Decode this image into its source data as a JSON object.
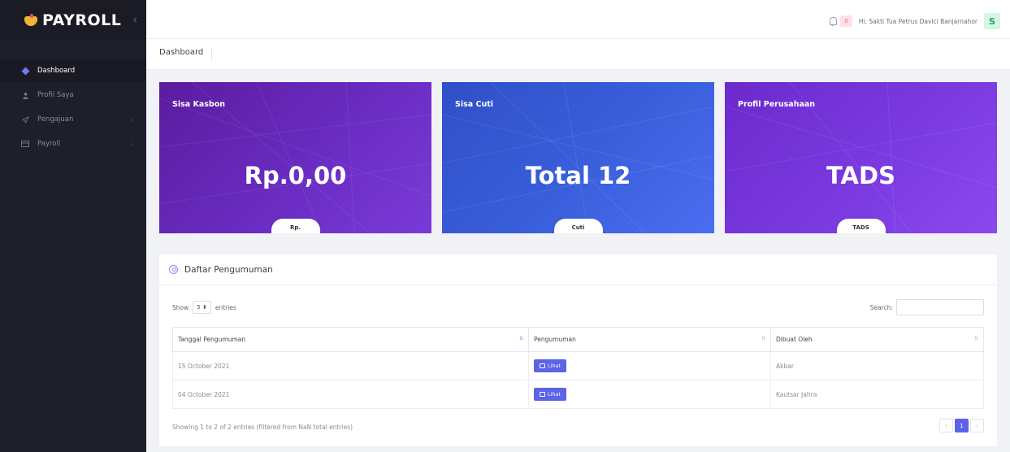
{
  "brand": {
    "bold": "PAYROLL",
    "collapse_icon": "chevron-left-icon"
  },
  "sidebar": {
    "items": [
      {
        "label": "Dashboard",
        "icon": "diamond-icon"
      },
      {
        "label": "Profil Saya",
        "icon": "user-icon"
      },
      {
        "label": "Pengajuan",
        "icon": "send-icon"
      },
      {
        "label": "Payroll",
        "icon": "credit-card-icon"
      }
    ]
  },
  "topbar": {
    "notif_count": "0",
    "greeting": "Hi, Sakti Tua Petrus Davici Banjarnahor",
    "avatar_letter": "S"
  },
  "breadcrumb": {
    "title": "Dashboard"
  },
  "cards": [
    {
      "title": "Sisa Kasbon",
      "value": "Rp.0,00",
      "pill": "Rp."
    },
    {
      "title": "Sisa Cuti",
      "value": "Total 12",
      "pill": "Cuti"
    },
    {
      "title": "Profil Perusahaan",
      "value": "TADS",
      "pill": "TADS"
    }
  ],
  "announcements": {
    "title": "Daftar Pengumuman",
    "show_label": "Show",
    "entries_value": "5",
    "entries_label": "entries",
    "search_label": "Search:",
    "columns": [
      "Tanggal Pengumuman",
      "Pengumuman",
      "Dibuat Oleh"
    ],
    "rows": [
      {
        "date": "15 October 2021",
        "button": "Lihat",
        "author": "Akbar"
      },
      {
        "date": "04 October 2021",
        "button": "Lihat",
        "author": "Kautsar Jahra"
      }
    ],
    "info": "Showing 1 to 2 of 2 entries (filtered from NaN total entries)",
    "pagination": {
      "prev": "‹",
      "current": "1",
      "next": "›"
    }
  },
  "colors": {
    "accent": "#5b63e6",
    "sidebar_bg": "#1f1f2b"
  }
}
